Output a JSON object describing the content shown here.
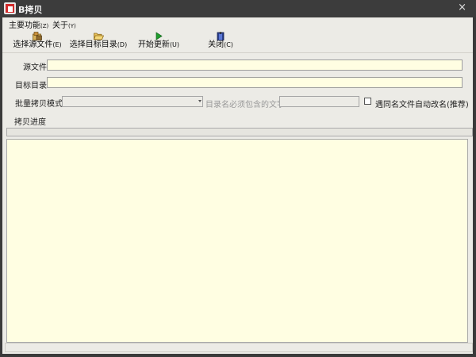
{
  "window": {
    "title": "B拷贝",
    "close_glyph": "×"
  },
  "menubar": {
    "items": [
      {
        "label": "主要功能",
        "accel": "(Z)"
      },
      {
        "label": "关于",
        "accel": "(Y)"
      }
    ]
  },
  "toolbar": {
    "buttons": [
      {
        "label": "选择源文件",
        "accel": "(E)",
        "icon": "package-folder-icon"
      },
      {
        "label": "选择目标目录",
        "accel": "(D)",
        "icon": "open-folder-icon"
      },
      {
        "label": "开始更新",
        "accel": "(U)",
        "icon": "play-icon"
      },
      {
        "label": "关闭",
        "accel": "(C)",
        "icon": "exit-door-icon"
      }
    ]
  },
  "form": {
    "source_label": "源文件",
    "source_value": "",
    "target_label": "目标目录",
    "target_value": "",
    "batch_mode_label": "批量拷贝模式",
    "batch_mode_value": "",
    "dir_contains_label": "目录名必须包含的文字",
    "dir_contains_value": "",
    "auto_rename_label": "遇同名文件自动改名(推荐)",
    "auto_rename_checked": false,
    "progress_label": "拷贝进度",
    "progress_fraction": 0
  },
  "colors": {
    "titlebar": "#3c3c3c",
    "client": "#ecebe6",
    "input_bg": "#fffee2",
    "accent_red": "#d22b2b"
  }
}
